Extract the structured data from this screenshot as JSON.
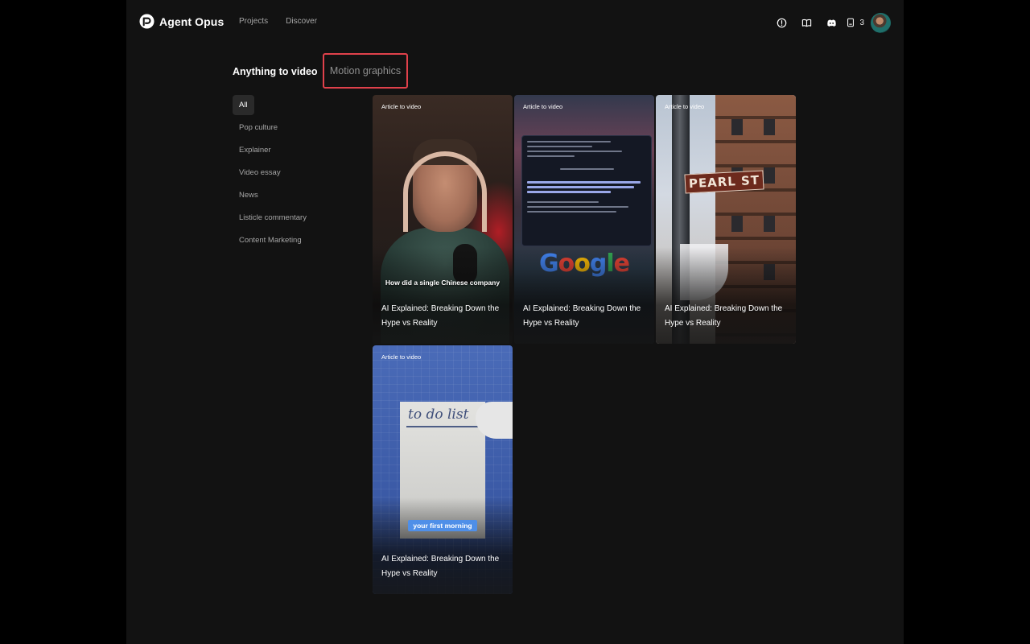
{
  "header": {
    "brand": "Agent Opus",
    "nav": [
      "Projects",
      "Discover"
    ],
    "credits": "3",
    "icons": [
      "info-icon",
      "book-icon",
      "discord-icon",
      "credits-icon"
    ]
  },
  "tabs": {
    "main": "Anything to video",
    "motion": "Motion graphics"
  },
  "categories": [
    "All",
    "Pop culture",
    "Explainer",
    "Video essay",
    "News",
    "Listicle commentary",
    "Content Marketing"
  ],
  "cards": [
    {
      "badge": "Article to video",
      "caption": "How did a single Chinese company",
      "title": "AI Explained: Breaking Down the Hype vs Reality"
    },
    {
      "badge": "Article to video",
      "logo_text": "Google",
      "title": "AI Explained: Breaking Down the Hype vs Reality"
    },
    {
      "badge": "Article to video",
      "sign_text": "PEARL ST",
      "title": "AI Explained: Breaking Down the Hype vs Reality"
    },
    {
      "badge": "Article to video",
      "paper_text": "to do list",
      "pill": "your first morning",
      "title": "AI Explained: Breaking Down the Hype vs Reality"
    }
  ],
  "colors": {
    "background": "#121212",
    "highlight_border": "#e0414b",
    "active_category": "#2a2a2a"
  }
}
